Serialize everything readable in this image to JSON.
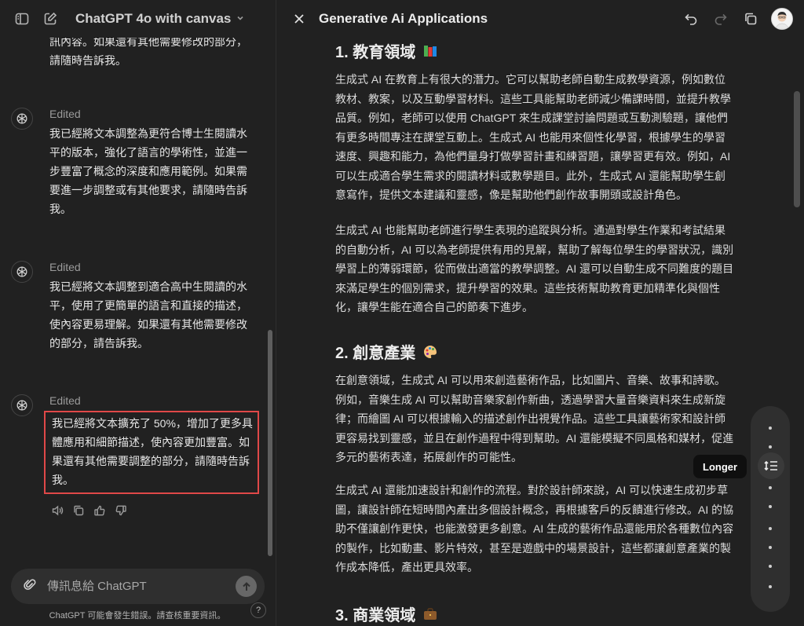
{
  "left_header": {
    "model_title": "ChatGPT 4o with canvas",
    "sidebar_icon": "sidebar-toggle-icon",
    "new_chat_icon": "new-chat-icon"
  },
  "chat": {
    "truncated_lines": [
      "訊內容。如果還有其他需要修改的部分，",
      "請隨時告訴我。"
    ],
    "messages": [
      {
        "edited": "Edited",
        "text": "我已經將文本調整為更符合博士生閱讀水平的版本，強化了語言的學術性，並進一步豐富了概念的深度和應用範例。如果需要進一步調整或有其他要求，請隨時告訴我。"
      },
      {
        "edited": "Edited",
        "text": "我已經將文本調整到適合高中生閱讀的水平，使用了更簡單的語言和直接的描述，使內容更易理解。如果還有其他需要修改的部分，請告訴我。"
      },
      {
        "edited": "Edited",
        "text": "我已經將文本擴充了 50%，增加了更多具體應用和細節描述，使內容更加豐富。如果還有其他需要調整的部分，請隨時告訴我。"
      }
    ],
    "action_icons": [
      "speaker-icon",
      "copy-icon",
      "thumbs-up-icon",
      "thumbs-down-icon"
    ]
  },
  "composer": {
    "placeholder": "傳訊息給 ChatGPT",
    "disclaimer": "ChatGPT 可能會發生錯誤。請查核重要資訊。",
    "help": "?"
  },
  "canvas": {
    "title": "Generative Ai Applications",
    "sections": [
      {
        "heading": "1. 教育領域",
        "emoji": "📚",
        "paragraphs": [
          "生成式 AI 在教育上有很大的潛力。它可以幫助老師自動生成教學資源，例如數位教材、教案，以及互動學習材料。這些工具能幫助老師減少備課時間，並提升教學品質。例如，老師可以使用 ChatGPT 來生成課堂討論問題或互動測驗題，讓他們有更多時間專注在課堂互動上。生成式 AI 也能用來個性化學習，根據學生的學習速度、興趣和能力，為他們量身打做學習計畫和練習題，讓學習更有效。例如，AI 可以生成適合學生需求的閱讀材料或數學題目。此外，生成式 AI 還能幫助學生創意寫作，提供文本建議和靈感，像是幫助他們創作故事開頭或設計角色。",
          "生成式 AI 也能幫助老師進行學生表現的追蹤與分析。通過對學生作業和考試結果的自動分析，AI 可以為老師提供有用的見解，幫助了解每位學生的學習狀況，識別學習上的薄弱環節，從而做出適當的教學調整。AI 還可以自動生成不同難度的題目來滿足學生的個別需求，提升學習的效果。這些技術幫助教育更加精準化與個性化，讓學生能在適合自己的節奏下進步。"
        ]
      },
      {
        "heading": "2. 創意產業",
        "emoji": "🎨",
        "paragraphs": [
          "在創意領域，生成式 AI 可以用來創造藝術作品，比如圖片、音樂、故事和詩歌。例如，音樂生成 AI 可以幫助音樂家創作新曲，透過學習大量音樂資料來生成新旋律；而繪圖 AI 可以根據輸入的描述創作出視覺作品。這些工具讓藝術家和設計師更容易找到靈感，並且在創作過程中得到幫助。AI 還能模擬不同風格和媒材，促進多元的藝術表達，拓展創作的可能性。",
          "生成式 AI 還能加速設計和創作的流程。對於設計師來說，AI 可以快速生成初步草圖，讓設計師在短時間內產出多個設計概念，再根據客戶的反饋進行修改。AI 的協助不僅讓創作更快，也能激發更多創意。AI 生成的藝術作品還能用於各種數位內容的製作，比如動畫、影片特效，甚至是遊戲中的場景設計，這些都讓創意產業的製作成本降低，產出更具效率。"
        ]
      },
      {
        "heading": "3. 商業領域",
        "emoji": "💼",
        "paragraphs": []
      }
    ],
    "length_tooltip": "Longer",
    "header_icons": [
      "undo-icon",
      "redo-icon",
      "copy-icon",
      "user-avatar"
    ]
  }
}
